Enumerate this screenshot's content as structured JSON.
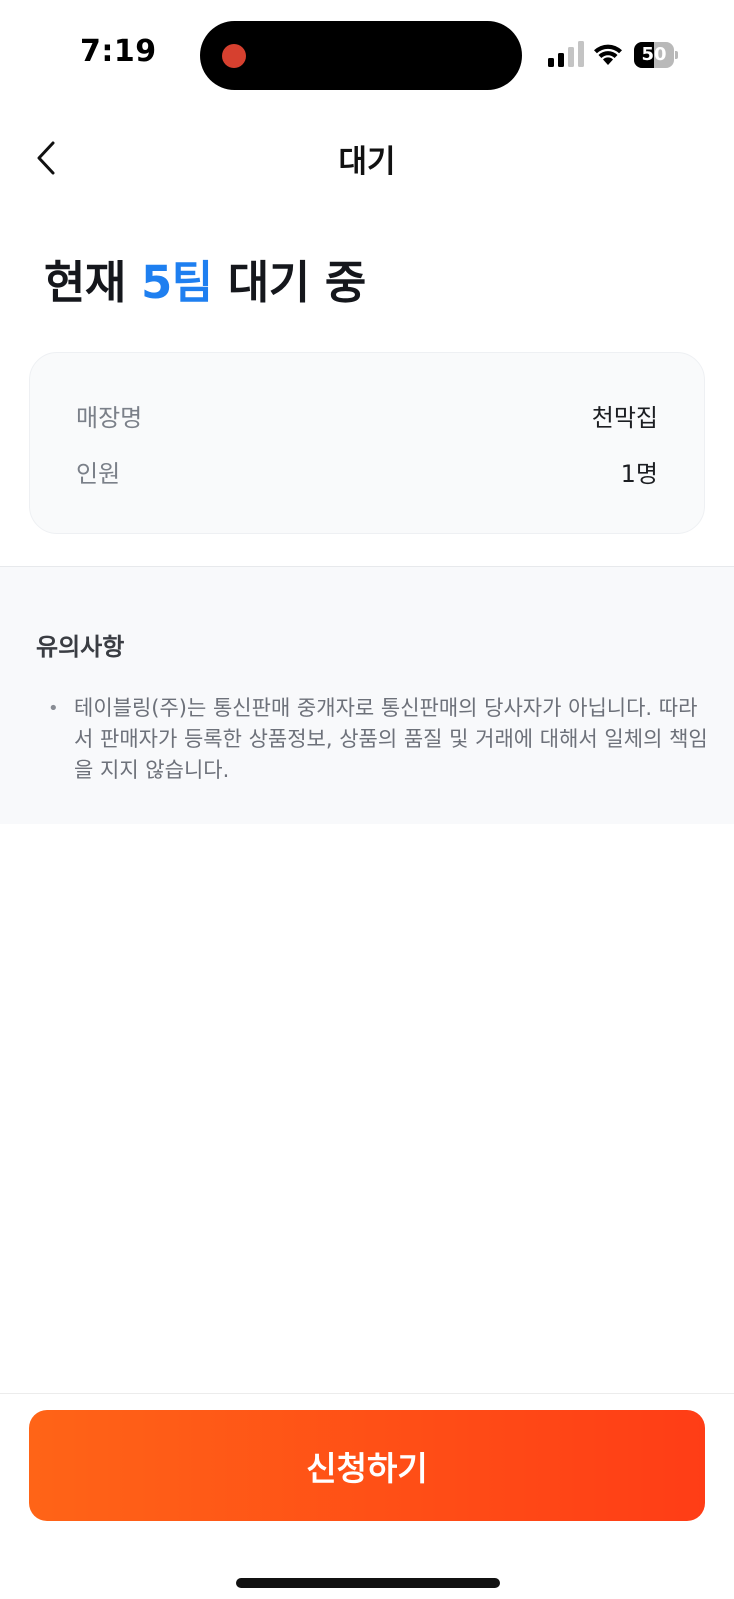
{
  "status_bar": {
    "time": "7:19",
    "battery_level": "50",
    "battery_fraction": 0.5
  },
  "header": {
    "title": "대기",
    "back_icon": "chevron-left-icon"
  },
  "headline": {
    "prefix": "현재 ",
    "count": "5팀",
    "suffix": " 대기 중"
  },
  "info": {
    "rows": [
      {
        "label": "매장명",
        "value": "천막집"
      },
      {
        "label": "인원",
        "value": "1명"
      }
    ]
  },
  "notice": {
    "title": "유의사항",
    "items": [
      "테이블링(주)는 통신판매 중개자로 통신판매의 당사자가 아닙니다. 따라서 판매자가 등록한 상품정보, 상품의 품질 및 거래에 대해서 일체의 책임을 지지 않습니다."
    ]
  },
  "actions": {
    "apply_label": "신청하기"
  },
  "colors": {
    "accent_blue": "#1e7ff0",
    "cta_start": "#ff6417",
    "cta_end": "#ff3d16"
  }
}
